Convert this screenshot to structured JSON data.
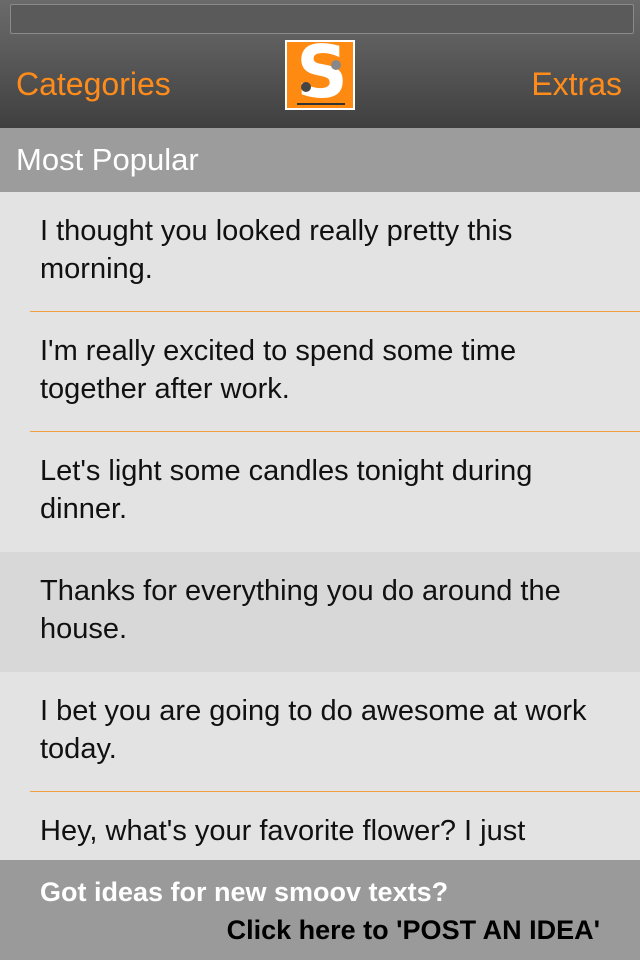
{
  "header": {
    "left_button": "Categories",
    "right_button": "Extras",
    "logo_letter": "S",
    "accent_color": "#ff8c1a"
  },
  "section": {
    "title": "Most Popular"
  },
  "items": [
    {
      "text": "I thought you looked really pretty this morning."
    },
    {
      "text": "I'm really excited to spend some time together after work."
    },
    {
      "text": "Let's light some candles tonight during dinner."
    },
    {
      "text": "Thanks for everything you do around the house."
    },
    {
      "text": "I bet you are going to do awesome at work today."
    },
    {
      "text": "Hey, what's your favorite flower? I just"
    }
  ],
  "footer": {
    "line1": "Got ideas for new smoov texts?",
    "line2": "Click here to 'POST AN IDEA'"
  }
}
